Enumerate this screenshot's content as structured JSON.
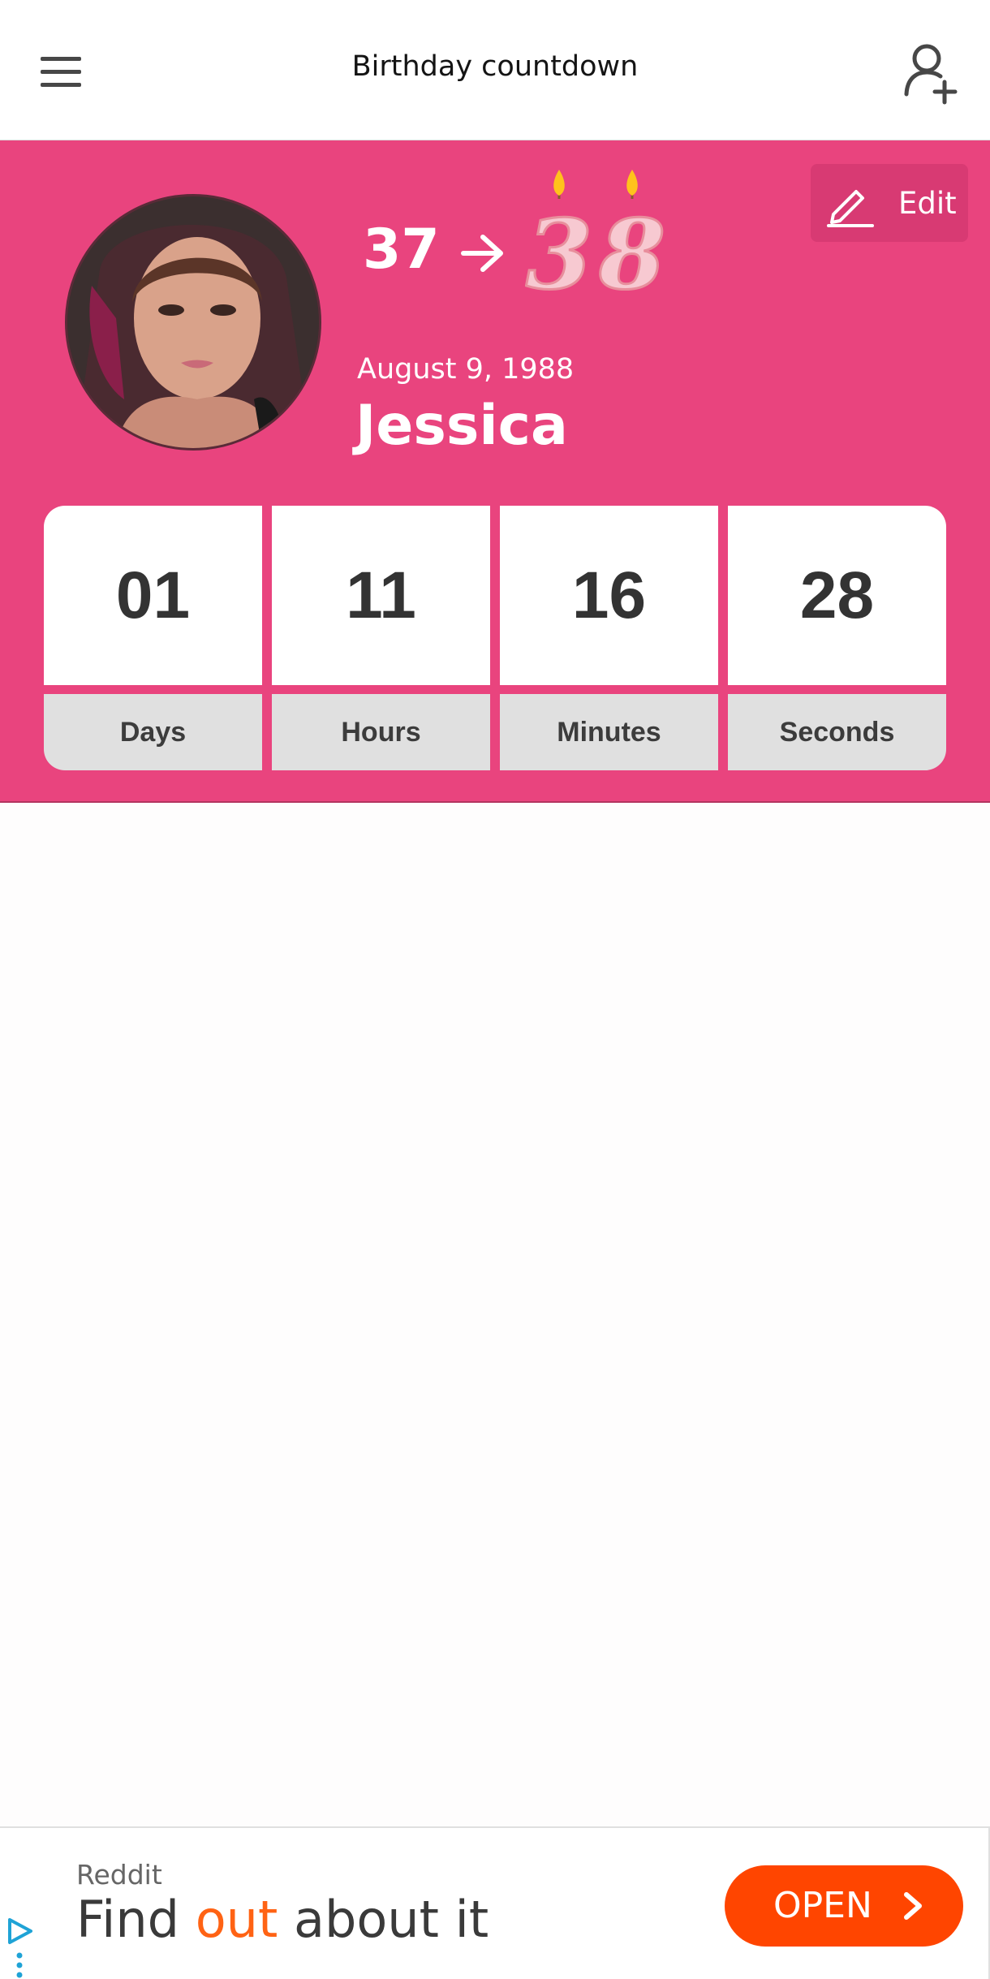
{
  "appbar": {
    "title": "Birthday countdown",
    "menu_icon": "hamburger-menu-icon",
    "add_icon": "add-person-icon"
  },
  "profile": {
    "current_age": "37",
    "next_age_digits": [
      "3",
      "8"
    ],
    "birth_date": "August 9, 1988",
    "name": "Jessica",
    "edit_label": "Edit"
  },
  "countdown": [
    {
      "value": "01",
      "unit": "Days"
    },
    {
      "value": "11",
      "unit": "Hours"
    },
    {
      "value": "16",
      "unit": "Minutes"
    },
    {
      "value": "28",
      "unit": "Seconds"
    }
  ],
  "ad": {
    "advertiser": "Reddit",
    "headline_1": "Find ",
    "headline_highlight": "out",
    "headline_2": " about it",
    "cta": "OPEN"
  },
  "colors": {
    "accent": "#e9447e",
    "ad_cta": "#ff4500",
    "ad_highlight": "#ff6314"
  }
}
